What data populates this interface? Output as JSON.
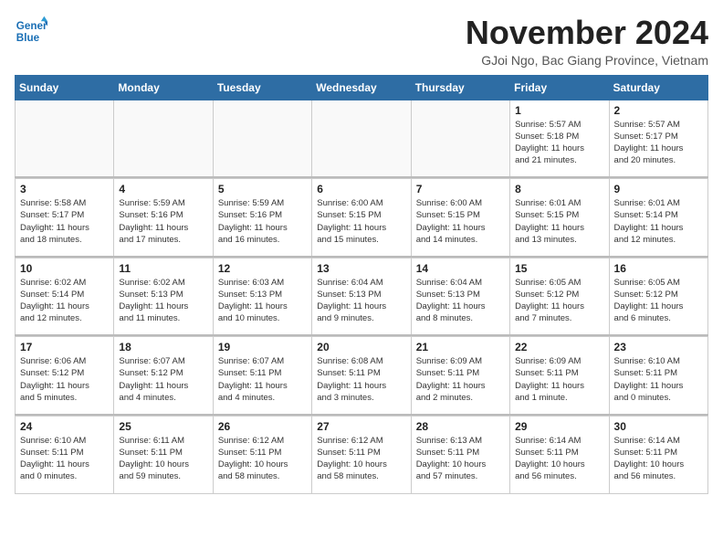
{
  "logo": {
    "line1": "General",
    "line2": "Blue"
  },
  "title": "November 2024",
  "location": "GJoi Ngo, Bac Giang Province, Vietnam",
  "weekdays": [
    "Sunday",
    "Monday",
    "Tuesday",
    "Wednesday",
    "Thursday",
    "Friday",
    "Saturday"
  ],
  "weeks": [
    [
      {
        "day": "",
        "info": ""
      },
      {
        "day": "",
        "info": ""
      },
      {
        "day": "",
        "info": ""
      },
      {
        "day": "",
        "info": ""
      },
      {
        "day": "",
        "info": ""
      },
      {
        "day": "1",
        "info": "Sunrise: 5:57 AM\nSunset: 5:18 PM\nDaylight: 11 hours\nand 21 minutes."
      },
      {
        "day": "2",
        "info": "Sunrise: 5:57 AM\nSunset: 5:17 PM\nDaylight: 11 hours\nand 20 minutes."
      }
    ],
    [
      {
        "day": "3",
        "info": "Sunrise: 5:58 AM\nSunset: 5:17 PM\nDaylight: 11 hours\nand 18 minutes."
      },
      {
        "day": "4",
        "info": "Sunrise: 5:59 AM\nSunset: 5:16 PM\nDaylight: 11 hours\nand 17 minutes."
      },
      {
        "day": "5",
        "info": "Sunrise: 5:59 AM\nSunset: 5:16 PM\nDaylight: 11 hours\nand 16 minutes."
      },
      {
        "day": "6",
        "info": "Sunrise: 6:00 AM\nSunset: 5:15 PM\nDaylight: 11 hours\nand 15 minutes."
      },
      {
        "day": "7",
        "info": "Sunrise: 6:00 AM\nSunset: 5:15 PM\nDaylight: 11 hours\nand 14 minutes."
      },
      {
        "day": "8",
        "info": "Sunrise: 6:01 AM\nSunset: 5:15 PM\nDaylight: 11 hours\nand 13 minutes."
      },
      {
        "day": "9",
        "info": "Sunrise: 6:01 AM\nSunset: 5:14 PM\nDaylight: 11 hours\nand 12 minutes."
      }
    ],
    [
      {
        "day": "10",
        "info": "Sunrise: 6:02 AM\nSunset: 5:14 PM\nDaylight: 11 hours\nand 12 minutes."
      },
      {
        "day": "11",
        "info": "Sunrise: 6:02 AM\nSunset: 5:13 PM\nDaylight: 11 hours\nand 11 minutes."
      },
      {
        "day": "12",
        "info": "Sunrise: 6:03 AM\nSunset: 5:13 PM\nDaylight: 11 hours\nand 10 minutes."
      },
      {
        "day": "13",
        "info": "Sunrise: 6:04 AM\nSunset: 5:13 PM\nDaylight: 11 hours\nand 9 minutes."
      },
      {
        "day": "14",
        "info": "Sunrise: 6:04 AM\nSunset: 5:13 PM\nDaylight: 11 hours\nand 8 minutes."
      },
      {
        "day": "15",
        "info": "Sunrise: 6:05 AM\nSunset: 5:12 PM\nDaylight: 11 hours\nand 7 minutes."
      },
      {
        "day": "16",
        "info": "Sunrise: 6:05 AM\nSunset: 5:12 PM\nDaylight: 11 hours\nand 6 minutes."
      }
    ],
    [
      {
        "day": "17",
        "info": "Sunrise: 6:06 AM\nSunset: 5:12 PM\nDaylight: 11 hours\nand 5 minutes."
      },
      {
        "day": "18",
        "info": "Sunrise: 6:07 AM\nSunset: 5:12 PM\nDaylight: 11 hours\nand 4 minutes."
      },
      {
        "day": "19",
        "info": "Sunrise: 6:07 AM\nSunset: 5:11 PM\nDaylight: 11 hours\nand 4 minutes."
      },
      {
        "day": "20",
        "info": "Sunrise: 6:08 AM\nSunset: 5:11 PM\nDaylight: 11 hours\nand 3 minutes."
      },
      {
        "day": "21",
        "info": "Sunrise: 6:09 AM\nSunset: 5:11 PM\nDaylight: 11 hours\nand 2 minutes."
      },
      {
        "day": "22",
        "info": "Sunrise: 6:09 AM\nSunset: 5:11 PM\nDaylight: 11 hours\nand 1 minute."
      },
      {
        "day": "23",
        "info": "Sunrise: 6:10 AM\nSunset: 5:11 PM\nDaylight: 11 hours\nand 0 minutes."
      }
    ],
    [
      {
        "day": "24",
        "info": "Sunrise: 6:10 AM\nSunset: 5:11 PM\nDaylight: 11 hours\nand 0 minutes."
      },
      {
        "day": "25",
        "info": "Sunrise: 6:11 AM\nSunset: 5:11 PM\nDaylight: 10 hours\nand 59 minutes."
      },
      {
        "day": "26",
        "info": "Sunrise: 6:12 AM\nSunset: 5:11 PM\nDaylight: 10 hours\nand 58 minutes."
      },
      {
        "day": "27",
        "info": "Sunrise: 6:12 AM\nSunset: 5:11 PM\nDaylight: 10 hours\nand 58 minutes."
      },
      {
        "day": "28",
        "info": "Sunrise: 6:13 AM\nSunset: 5:11 PM\nDaylight: 10 hours\nand 57 minutes."
      },
      {
        "day": "29",
        "info": "Sunrise: 6:14 AM\nSunset: 5:11 PM\nDaylight: 10 hours\nand 56 minutes."
      },
      {
        "day": "30",
        "info": "Sunrise: 6:14 AM\nSunset: 5:11 PM\nDaylight: 10 hours\nand 56 minutes."
      }
    ]
  ]
}
